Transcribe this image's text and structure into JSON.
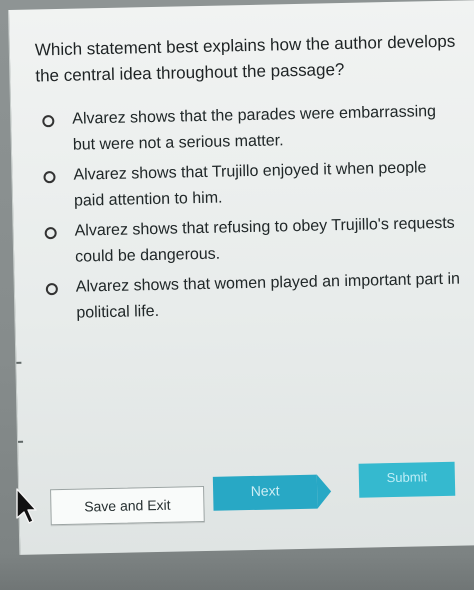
{
  "question": {
    "text": "Which statement best explains how the author develops the central idea throughout the passage?"
  },
  "options": [
    {
      "label": "Alvarez shows that the parades were embarrassing but were not a serious matter."
    },
    {
      "label": "Alvarez shows that Trujillo enjoyed it when people paid attention to him."
    },
    {
      "label": "Alvarez shows that refusing to obey Trujillo's requests could be dangerous."
    },
    {
      "label": "Alvarez shows that women played an important part in political life."
    }
  ],
  "buttons": {
    "save_exit": "Save and Exit",
    "next": "Next",
    "submit": "Submit"
  },
  "colors": {
    "next_button": "#28a8c5",
    "submit_button": "#35b9cf",
    "panel_background": "#eef1f0"
  },
  "icons": {
    "radio": "radio-button-icon",
    "cursor": "mouse-pointer-icon"
  }
}
